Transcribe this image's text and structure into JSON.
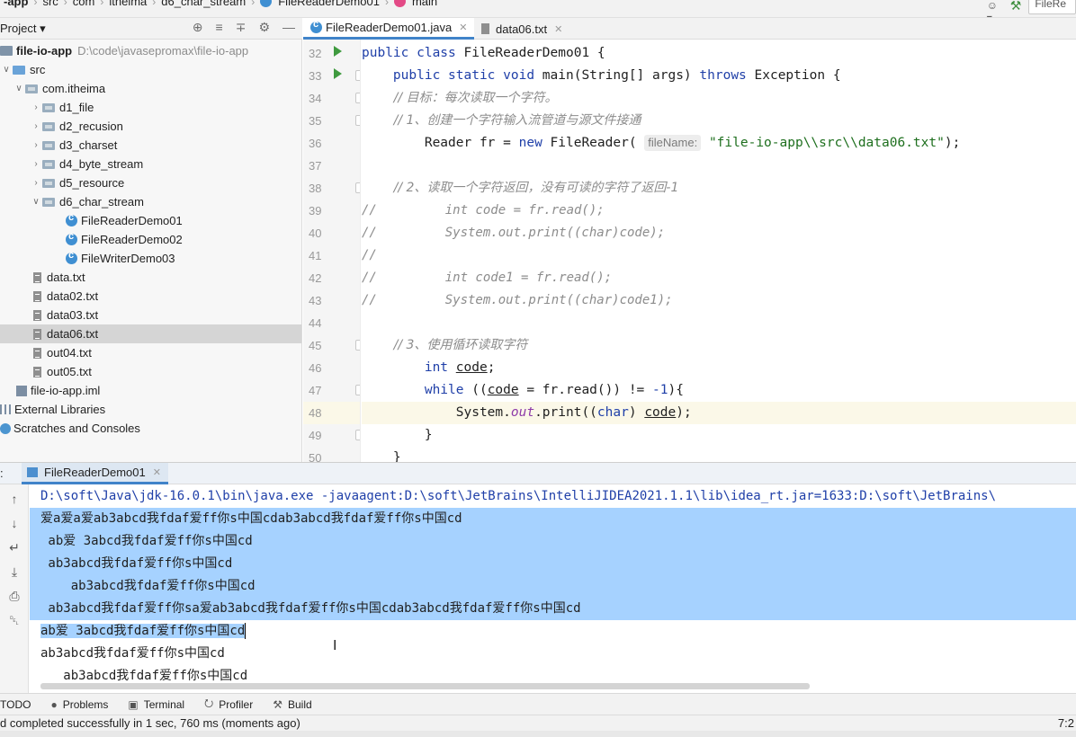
{
  "breadcrumb": {
    "items": [
      "-app",
      "src",
      "com",
      "itheima",
      "d6_char_stream",
      "FileReaderDemo01",
      "main"
    ],
    "run_config_label": "FileRe"
  },
  "project_panel": {
    "title": "Project ▾",
    "tree": [
      {
        "label": "file-io-app",
        "hint": "D:\\code\\javasepromax\\file-io-app",
        "kind": "module",
        "expanded": true
      },
      {
        "label": "src",
        "kind": "src-folder",
        "expanded": true
      },
      {
        "label": "com.itheima",
        "kind": "package",
        "expanded": true
      },
      {
        "label": "d1_file",
        "kind": "package",
        "expanded": false
      },
      {
        "label": "d2_recusion",
        "kind": "package",
        "expanded": false
      },
      {
        "label": "d3_charset",
        "kind": "package",
        "expanded": false
      },
      {
        "label": "d4_byte_stream",
        "kind": "package",
        "expanded": false
      },
      {
        "label": "d5_resource",
        "kind": "package",
        "expanded": false
      },
      {
        "label": "d6_char_stream",
        "kind": "package",
        "expanded": true
      },
      {
        "label": "FileReaderDemo01",
        "kind": "class"
      },
      {
        "label": "FileReaderDemo02",
        "kind": "class"
      },
      {
        "label": "FileWriterDemo03",
        "kind": "class"
      },
      {
        "label": "data.txt",
        "kind": "file"
      },
      {
        "label": "data02.txt",
        "kind": "file"
      },
      {
        "label": "data03.txt",
        "kind": "file"
      },
      {
        "label": "data06.txt",
        "kind": "file",
        "selected": true
      },
      {
        "label": "out04.txt",
        "kind": "file"
      },
      {
        "label": "out05.txt",
        "kind": "file"
      },
      {
        "label": "file-io-app.iml",
        "kind": "iml"
      },
      {
        "label": "External Libraries",
        "kind": "libs"
      },
      {
        "label": "Scratches and Consoles",
        "kind": "scratch"
      }
    ]
  },
  "editor": {
    "tabs": [
      {
        "label": "FileReaderDemo01.java",
        "active": true
      },
      {
        "label": "data06.txt",
        "active": false
      }
    ],
    "line_numbers": [
      "32",
      "33",
      "34",
      "35",
      "36",
      "37",
      "38",
      "39",
      "40",
      "41",
      "42",
      "43",
      "44",
      "45",
      "46",
      "47",
      "48",
      "49",
      "50"
    ],
    "lines": {
      "l32_kw": "public class ",
      "l32_rest": "FileReaderDemo01 {",
      "l33_kw": "    public static void ",
      "l33_mid": "main(String[] args) ",
      "l33_kw2": "throws ",
      "l33_rest": "Exception {",
      "l34": "        // 目标：每次读取一个字符。",
      "l35": "        // 1、创建一个字符输入流管道与源文件接通",
      "l36_a": "        Reader fr = ",
      "l36_kw": "new ",
      "l36_b": "FileReader( ",
      "l36_hint": "fileName:",
      "l36_str": " \"file-io-app\\\\src\\\\data06.txt\"",
      "l36_end": ");",
      "l38": "        // 2、读取一个字符返回，没有可读的字符了返回-1",
      "l39": "//         int code = fr.read();",
      "l40": "//         System.out.print((char)code);",
      "l41": "//",
      "l42": "//         int code1 = fr.read();",
      "l43": "//         System.out.print((char)code1);",
      "l45": "        // 3、使用循环读取字符",
      "l46_kw": "        int ",
      "l46_var": "code",
      "l46_end": ";",
      "l47_kw": "        while ",
      "l47_a": "((",
      "l47_var": "code",
      "l47_b": " = fr.read()) != ",
      "l47_num": "-1",
      "l47_c": "){",
      "l48_a": "            System.",
      "l48_fld": "out",
      "l48_b": ".print((",
      "l48_kw": "char",
      "l48_c": ") ",
      "l48_var": "code",
      "l48_d": ");",
      "l49": "        }",
      "l50": "    }"
    }
  },
  "run_panel": {
    "prefix": ":",
    "tab_label": "FileReaderDemo01",
    "command": "D:\\soft\\Java\\jdk-16.0.1\\bin\\java.exe -javaagent:D:\\soft\\JetBrains\\IntelliJIDEA2021.1.1\\lib\\idea_rt.jar=1633:D:\\soft\\JetBrains\\",
    "output": [
      "爱a爱a爱ab3abcd我fdaf爱ff你s中国cdab3abcd我fdaf爱ff你s中国cd",
      " ab爱 3abcd我fdaf爱ff你s中国cd",
      " ab3abcd我fdaf爱ff你s中国cd",
      "    ab3abcd我fdaf爱ff你s中国cd",
      " ab3abcd我fdaf爱ff你sa爱ab3abcd我fdaf爱ff你s中国cdab3abcd我fdaf爱ff你s中国cd",
      "ab爱 3abcd我fdaf爱ff你s中国cd",
      "ab3abcd我fdaf爱ff你s中国cd",
      "   ab3abcd我fdaf爱ff你s中国cd"
    ]
  },
  "tool_windows": [
    "TODO",
    "Problems",
    "Terminal",
    "Profiler",
    "Build"
  ],
  "status": {
    "message": "d completed successfully in 1 sec, 760 ms (moments ago)",
    "position": "7:2"
  },
  "colors": {
    "selection": "#a6d2ff",
    "keyword": "#1f3fa8",
    "string": "#1e6f1e",
    "comment": "#8c8c8c",
    "accent": "#4083c9"
  }
}
